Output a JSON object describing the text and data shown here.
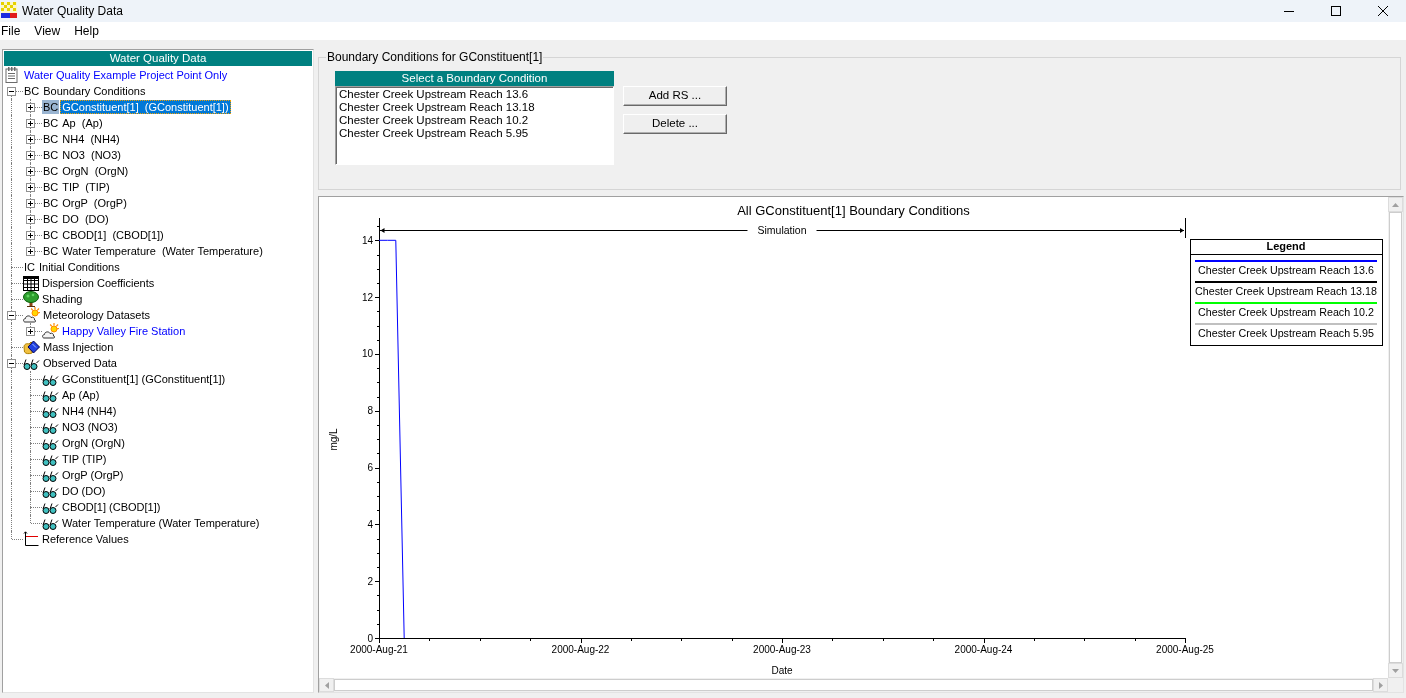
{
  "window": {
    "title": "Water Quality Data"
  },
  "menu": [
    "File",
    "View",
    "Help"
  ],
  "tree": {
    "header": "Water Quality Data",
    "project": {
      "label": "Water Quality Example Project Point Only",
      "selected": false
    },
    "items": [
      {
        "kind": "code",
        "prefix": "BC",
        "label": "Boundary Conditions",
        "expanded": true,
        "selected": false,
        "children": [
          {
            "kind": "code",
            "prefix": "BC",
            "label": "GConstituent[1]  (GConstituent[1])",
            "expanded": false,
            "selected": true
          },
          {
            "kind": "code",
            "prefix": "BC",
            "label": "Ap  (Ap)",
            "expanded": false,
            "selected": false
          },
          {
            "kind": "code",
            "prefix": "BC",
            "label": "NH4  (NH4)",
            "expanded": false,
            "selected": false
          },
          {
            "kind": "code",
            "prefix": "BC",
            "label": "NO3  (NO3)",
            "expanded": false,
            "selected": false
          },
          {
            "kind": "code",
            "prefix": "BC",
            "label": "OrgN  (OrgN)",
            "expanded": false,
            "selected": false
          },
          {
            "kind": "code",
            "prefix": "BC",
            "label": "TIP  (TIP)",
            "expanded": false,
            "selected": false
          },
          {
            "kind": "code",
            "prefix": "BC",
            "label": "OrgP  (OrgP)",
            "expanded": false,
            "selected": false
          },
          {
            "kind": "code",
            "prefix": "BC",
            "label": "DO  (DO)",
            "expanded": false,
            "selected": false
          },
          {
            "kind": "code",
            "prefix": "BC",
            "label": "CBOD[1]  (CBOD[1])",
            "expanded": false,
            "selected": false
          },
          {
            "kind": "code",
            "prefix": "BC",
            "label": "Water Temperature  (Water Temperature)",
            "expanded": false,
            "selected": false
          }
        ]
      },
      {
        "kind": "code",
        "prefix": "IC",
        "label": "Initial Conditions",
        "selected": false
      },
      {
        "kind": "grid",
        "label": "Dispersion Coefficients",
        "selected": false
      },
      {
        "kind": "tree",
        "label": "Shading",
        "selected": false
      },
      {
        "kind": "weather",
        "label": "Meteorology Datasets",
        "expanded": true,
        "selected": false,
        "children": [
          {
            "kind": "station",
            "label": "Happy Valley Fire Station",
            "expanded": false,
            "selected": false
          }
        ]
      },
      {
        "kind": "injection",
        "label": "Mass Injection",
        "selected": false
      },
      {
        "kind": "observed",
        "label": "Observed Data",
        "expanded": true,
        "selected": false,
        "children": [
          {
            "kind": "observed",
            "label": "GConstituent[1] (GConstituent[1])",
            "selected": false
          },
          {
            "kind": "observed",
            "label": "Ap (Ap)",
            "selected": false
          },
          {
            "kind": "observed",
            "label": "NH4 (NH4)",
            "selected": false
          },
          {
            "kind": "observed",
            "label": "NO3 (NO3)",
            "selected": false
          },
          {
            "kind": "observed",
            "label": "OrgN (OrgN)",
            "selected": false
          },
          {
            "kind": "observed",
            "label": "TIP (TIP)",
            "selected": false
          },
          {
            "kind": "observed",
            "label": "OrgP (OrgP)",
            "selected": false
          },
          {
            "kind": "observed",
            "label": "DO (DO)",
            "selected": false
          },
          {
            "kind": "observed",
            "label": "CBOD[1] (CBOD[1])",
            "selected": false
          },
          {
            "kind": "observed",
            "label": "Water Temperature (Water Temperature)",
            "selected": false
          }
        ]
      },
      {
        "kind": "axes",
        "label": "Reference Values",
        "selected": false
      }
    ]
  },
  "boundary_panel": {
    "title": "Boundary Conditions for GConstituent[1]",
    "list": {
      "header": "Select a Boundary Condition",
      "items": [
        {
          "label": "Chester Creek Upstream Reach 13.6",
          "selected": false
        },
        {
          "label": "Chester Creek Upstream Reach 13.18",
          "selected": false
        },
        {
          "label": "Chester Creek Upstream Reach 10.2",
          "selected": false
        },
        {
          "label": "Chester Creek Upstream Reach 5.95",
          "selected": false
        }
      ]
    },
    "buttons": [
      "Add RS ...",
      "Delete ..."
    ]
  },
  "chart": {
    "legend": {
      "title": "Legend",
      "items": [
        {
          "label": "Chester Creek Upstream Reach 13.6",
          "color": "#0000ff"
        },
        {
          "label": "Chester Creek Upstream Reach 13.18",
          "color": "#000000"
        },
        {
          "label": "Chester Creek Upstream Reach 10.2",
          "color": "#00ff00"
        },
        {
          "label": "Chester Creek Upstream Reach 5.95",
          "color": "#c0c0c0"
        }
      ]
    },
    "chart_data": {
      "type": "line",
      "title": "All GConstituent[1] Boundary Conditions",
      "xlabel": "Date",
      "ylabel": "mg/L",
      "categories": [
        "2000-Aug-21",
        null,
        null,
        null,
        null,
        null,
        null,
        null,
        null,
        null,
        null,
        null,
        null,
        null,
        null,
        null,
        null,
        null,
        null,
        null,
        null,
        null,
        null,
        null,
        "2000-Aug-22",
        null,
        null,
        null,
        null,
        null,
        null,
        null,
        null,
        null,
        null,
        null,
        null,
        null,
        null,
        null,
        null,
        null,
        null,
        null,
        null,
        null,
        null,
        null,
        "2000-Aug-23",
        null,
        null,
        null,
        null,
        null,
        null,
        null,
        null,
        null,
        null,
        null,
        null,
        null,
        null,
        null,
        null,
        null,
        null,
        null,
        null,
        null,
        null,
        null,
        "2000-Aug-24",
        null,
        null,
        null,
        null,
        null,
        null,
        null,
        null,
        null,
        null,
        null,
        null,
        null,
        null,
        null,
        null,
        null,
        null,
        null,
        null,
        null,
        null,
        null,
        "2000-Aug-25"
      ],
      "series": [
        {
          "color": "#0000ff",
          "values": [
            14,
            14,
            14,
            0,
            null,
            null,
            null,
            null,
            null,
            null,
            null,
            null,
            null,
            null,
            null,
            null,
            null,
            null,
            null,
            null,
            null,
            null,
            null,
            null,
            null,
            null,
            null,
            null,
            null,
            null,
            null,
            null,
            null,
            null,
            null,
            null,
            null,
            null,
            null,
            null,
            null,
            null,
            null,
            null,
            null,
            null,
            null,
            null,
            null,
            null,
            null,
            null,
            null,
            null,
            null,
            null,
            null,
            null,
            null,
            null,
            null,
            null,
            null,
            null,
            null,
            null,
            null,
            null,
            null,
            null,
            null,
            null,
            null,
            null,
            null,
            null,
            null,
            null,
            null,
            null,
            null,
            null,
            null,
            null,
            null,
            null,
            null,
            null,
            null,
            null,
            null,
            null,
            null,
            null,
            null,
            null,
            null
          ]
        }
      ],
      "ylim": [
        0,
        14.75
      ],
      "yticks": [
        0,
        2,
        4,
        6,
        8,
        10,
        12,
        14
      ],
      "annotations": [
        "Simulation"
      ]
    }
  }
}
